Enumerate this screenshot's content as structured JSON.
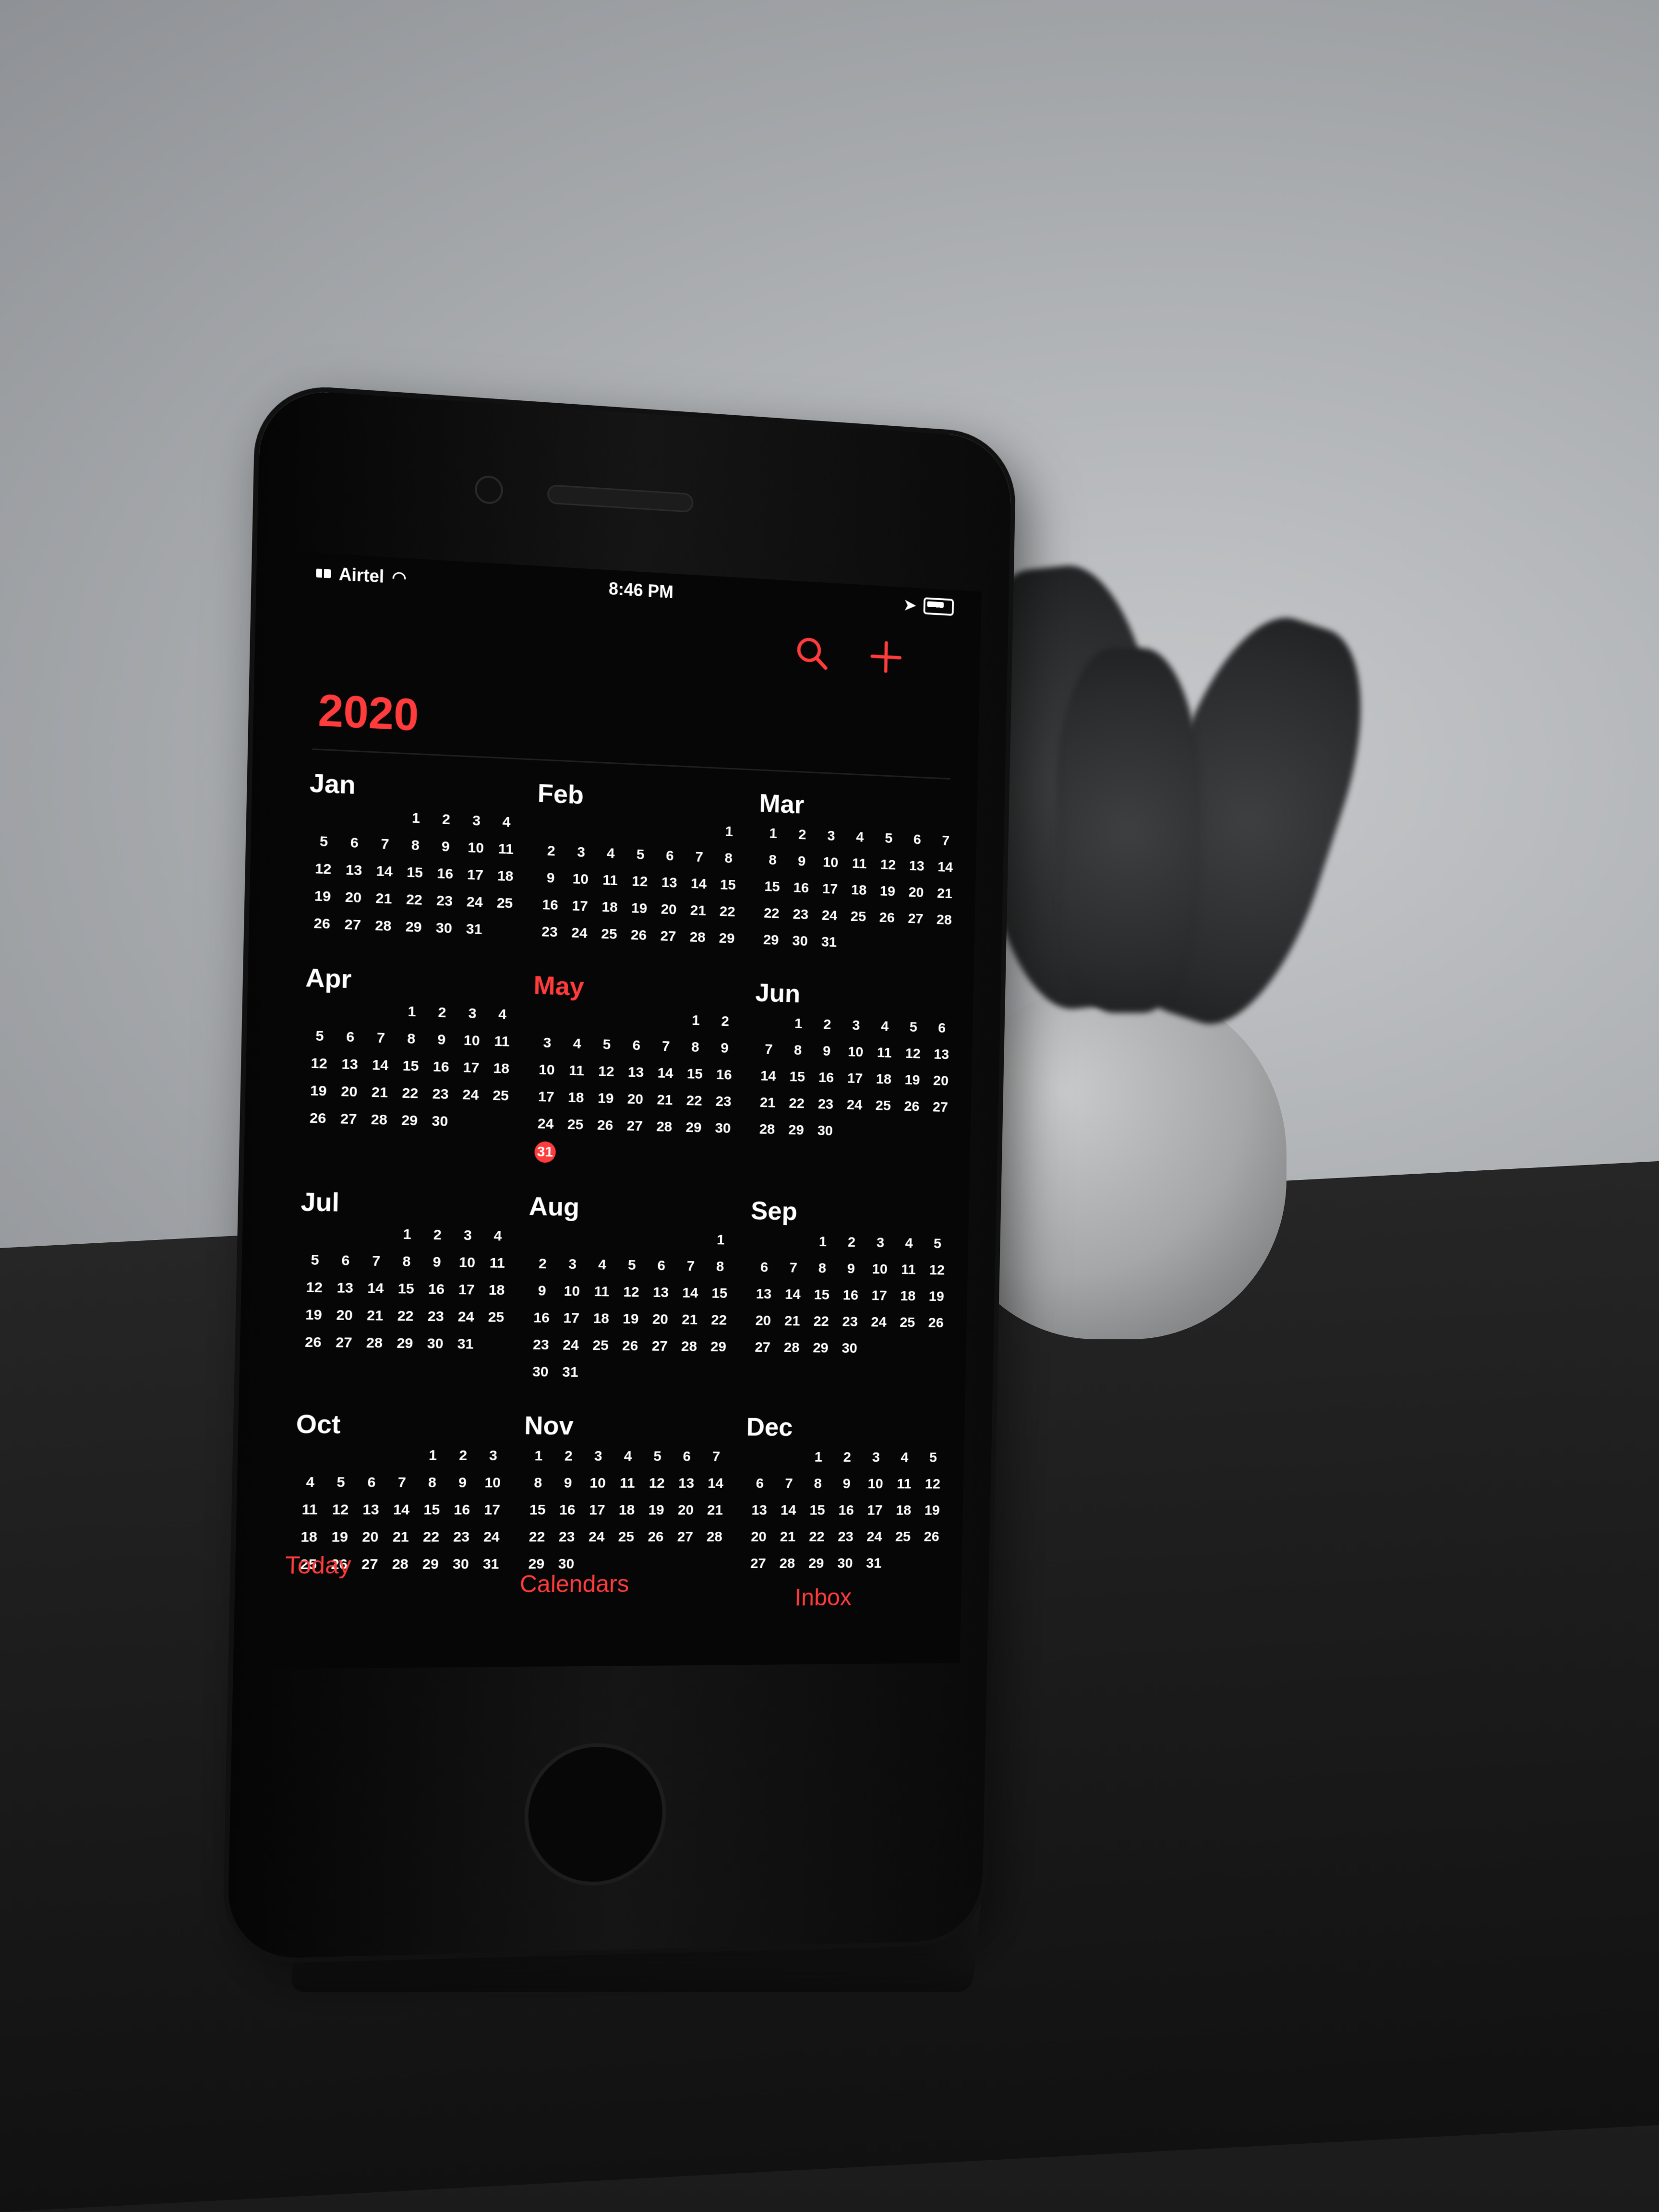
{
  "status": {
    "carrier": "Airtel",
    "time": "8:46 PM"
  },
  "year": "2020",
  "months": [
    {
      "name": "Jan",
      "offset": 3,
      "days": 31
    },
    {
      "name": "Feb",
      "offset": 6,
      "days": 29
    },
    {
      "name": "Mar",
      "offset": 0,
      "days": 31
    },
    {
      "name": "Apr",
      "offset": 3,
      "days": 30
    },
    {
      "name": "May",
      "offset": 5,
      "days": 31,
      "current": true,
      "today": 31
    },
    {
      "name": "Jun",
      "offset": 1,
      "days": 30
    },
    {
      "name": "Jul",
      "offset": 3,
      "days": 31
    },
    {
      "name": "Aug",
      "offset": 6,
      "days": 31
    },
    {
      "name": "Sep",
      "offset": 2,
      "days": 30
    },
    {
      "name": "Oct",
      "offset": 4,
      "days": 31
    },
    {
      "name": "Nov",
      "offset": 0,
      "days": 30
    },
    {
      "name": "Dec",
      "offset": 2,
      "days": 31
    }
  ],
  "tabs": {
    "today": "Today",
    "calendars": "Calendars",
    "inbox": "Inbox"
  },
  "icons": {
    "search": "search-icon",
    "add": "plus-icon"
  },
  "colors": {
    "accent": "#ff3b3b"
  }
}
